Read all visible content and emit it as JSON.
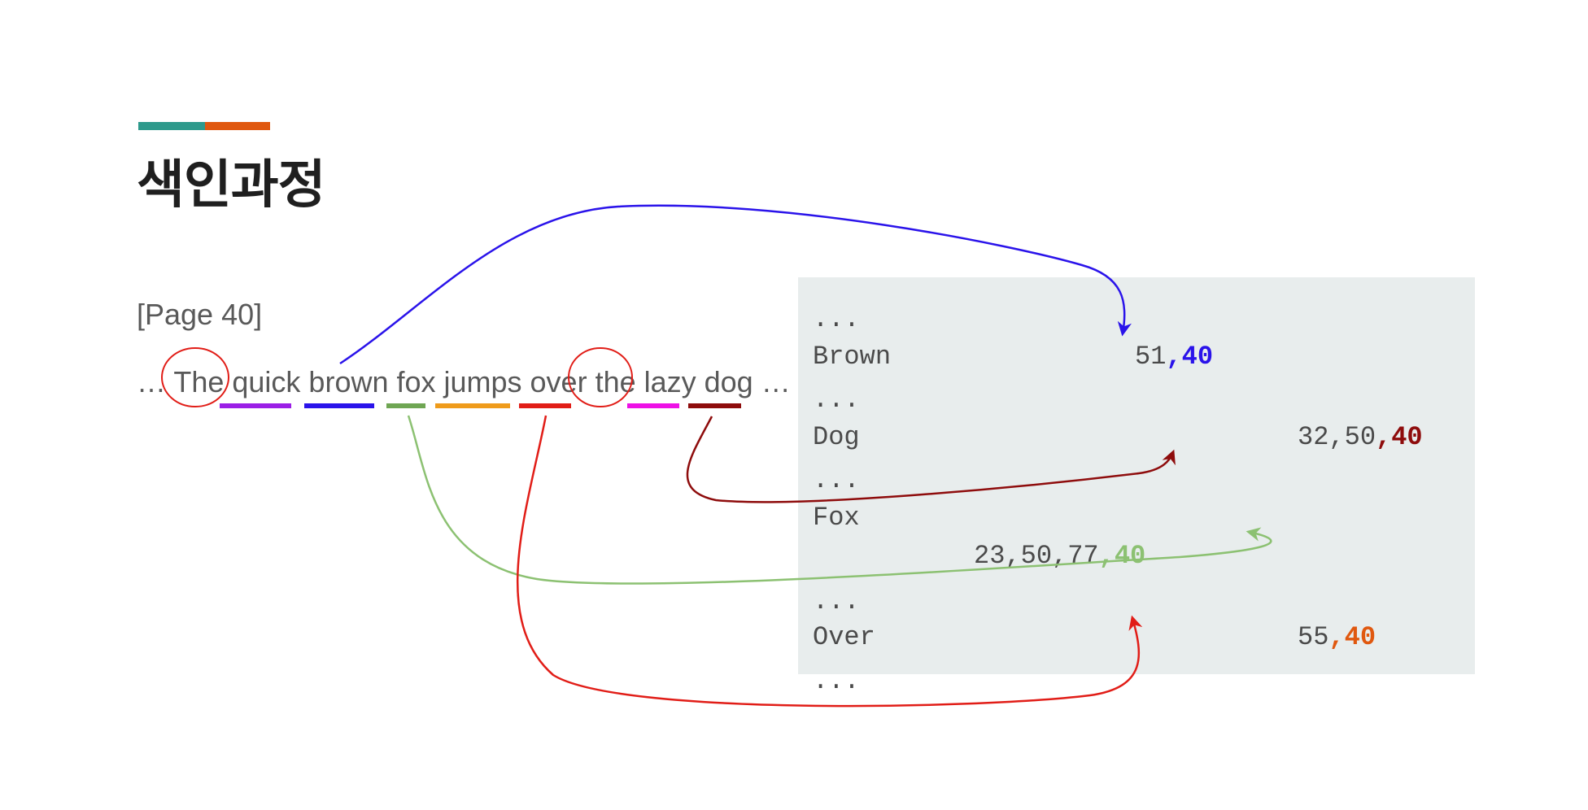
{
  "header": {
    "title": "색인과정",
    "accent_colors": [
      "#2e9a8c",
      "#e0580f"
    ]
  },
  "source": {
    "page_ref": "[Page 40]",
    "sentence": "… The quick brown fox jumps over the lazy dog …",
    "circled_stopwords": [
      "The",
      "the"
    ],
    "underline_colors": [
      "#9b1ee6",
      "#2a13ea",
      "#6fa653",
      "#ef9b1b",
      "#e11d17",
      "#ee10e6",
      "#8e0c0c"
    ]
  },
  "index": {
    "entries": [
      {
        "term": "...",
        "postings": "",
        "page": ""
      },
      {
        "term": "Brown",
        "postings": "51",
        "page": ",40",
        "color": "#2a13ea"
      },
      {
        "term": "...",
        "postings": "",
        "page": ""
      },
      {
        "term": "Dog",
        "postings": "32,50",
        "page": ",40",
        "color": "#8e0c0c"
      },
      {
        "term": "...",
        "postings": "",
        "page": ""
      },
      {
        "term": "Fox",
        "postings": "23,50,77",
        "page": ",40",
        "color": "#8cc172"
      },
      {
        "term": "...",
        "postings": "",
        "page": ""
      },
      {
        "term": "Over",
        "postings": "55",
        "page": ",40",
        "color": "#e0580f"
      },
      {
        "term": "...",
        "postings": "",
        "page": ""
      }
    ]
  },
  "arrow_colors": {
    "brown": "#2a13ea",
    "dog": "#8e0c0c",
    "fox": "#8cc172",
    "over": "#e11d17"
  }
}
